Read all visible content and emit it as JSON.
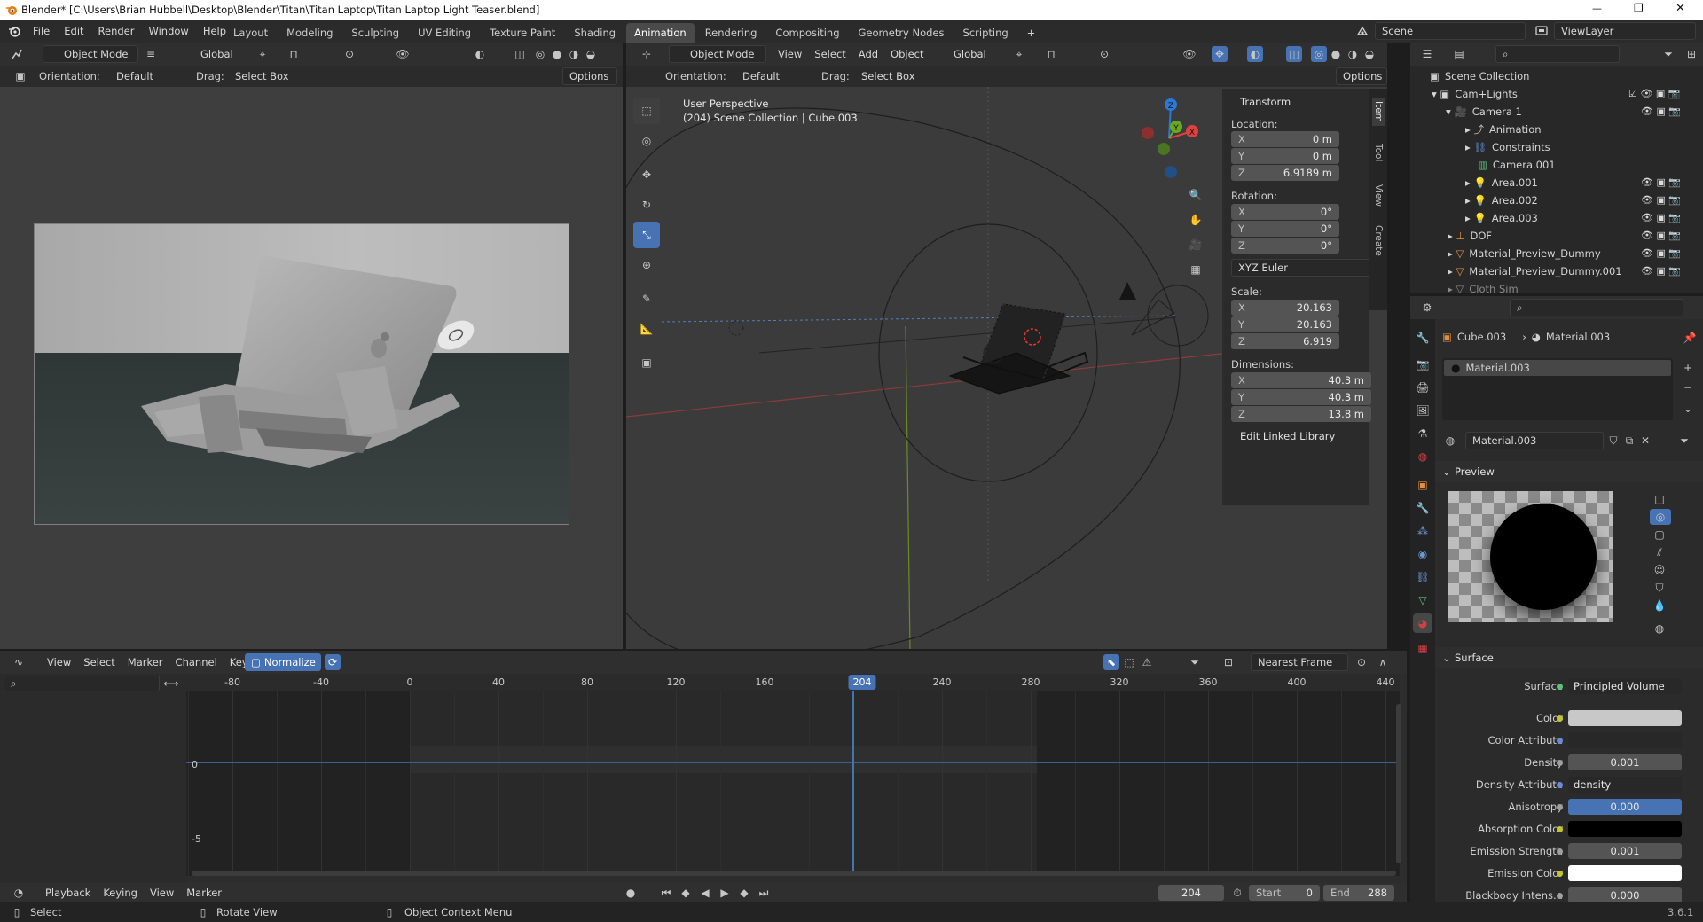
{
  "window": {
    "title": "Blender* [C:\\Users\\Brian Hubbell\\Desktop\\Blender\\Titan\\Titan Laptop\\Titan Laptop Light Teaser.blend]",
    "controls": {
      "minimize": "—",
      "maximize": "❐",
      "close": "✕"
    }
  },
  "menubar": {
    "items": [
      "File",
      "Edit",
      "Render",
      "Window",
      "Help"
    ],
    "workspaces": [
      "Layout",
      "Modeling",
      "Sculpting",
      "UV Editing",
      "Texture Paint",
      "Shading",
      "Animation",
      "Rendering",
      "Compositing",
      "Geometry Nodes",
      "Scripting"
    ],
    "active_workspace": "Animation",
    "add_tab": "+",
    "scene": "Scene",
    "view_layer": "ViewLayer"
  },
  "left_viewport": {
    "mode": "Object Mode",
    "transform": "Global",
    "orientation_label": "Orientation:",
    "orientation_value": "Default",
    "drag_label": "Drag:",
    "drag_value": "Select Box",
    "options": "Options"
  },
  "main_viewport": {
    "mode": "Object Mode",
    "menus": [
      "View",
      "Select",
      "Add",
      "Object"
    ],
    "transform": "Global",
    "orientation_label": "Orientation:",
    "orientation_value": "Default",
    "drag_label": "Drag:",
    "drag_value": "Select Box",
    "options": "Options",
    "overlay_title": "User Perspective",
    "overlay_path": "(204) Scene Collection | Cube.003",
    "side_tabs": [
      "Item",
      "Tool",
      "View",
      "Create"
    ],
    "gizmo": {
      "z": "Z",
      "y": "Y",
      "x": "X"
    }
  },
  "transform_panel": {
    "title": "Transform",
    "location_label": "Location:",
    "location": [
      {
        "k": "X",
        "v": "0 m"
      },
      {
        "k": "Y",
        "v": "0 m"
      },
      {
        "k": "Z",
        "v": "6.9189 m"
      }
    ],
    "rotation_label": "Rotation:",
    "rotation": [
      {
        "k": "X",
        "v": "0°"
      },
      {
        "k": "Y",
        "v": "0°"
      },
      {
        "k": "Z",
        "v": "0°"
      }
    ],
    "rotation_mode": "XYZ Euler",
    "scale_label": "Scale:",
    "scale": [
      {
        "k": "X",
        "v": "20.163"
      },
      {
        "k": "Y",
        "v": "20.163"
      },
      {
        "k": "Z",
        "v": "6.919"
      }
    ],
    "dimensions_label": "Dimensions:",
    "dimensions": [
      {
        "k": "X",
        "v": "40.3 m"
      },
      {
        "k": "Y",
        "v": "40.3 m"
      },
      {
        "k": "Z",
        "v": "13.8 m"
      }
    ],
    "linked_library": "Edit Linked Library"
  },
  "outliner": {
    "rows": [
      {
        "label": "Scene Collection"
      },
      {
        "label": "Cam+Lights"
      },
      {
        "label": "Camera 1"
      },
      {
        "label": "Animation"
      },
      {
        "label": "Constraints"
      },
      {
        "label": "Camera.001"
      },
      {
        "label": "Area.001"
      },
      {
        "label": "Area.002"
      },
      {
        "label": "Area.003"
      },
      {
        "label": "DOF"
      },
      {
        "label": "Material_Preview_Dummy"
      },
      {
        "label": "Material_Preview_Dummy.001"
      },
      {
        "label": "Cloth Sim"
      }
    ]
  },
  "properties": {
    "breadcrumb_object": "Cube.003",
    "breadcrumb_material": "Material.003",
    "slot": "Material.003",
    "material_name": "Material.003",
    "preview_title": "Preview",
    "surface_title": "Surface",
    "surface_label": "Surface",
    "surface_shader": "Principled Volume",
    "rows": [
      {
        "label": "Color",
        "value": "",
        "dot": "#c6c62a",
        "kind": "swatch-grey"
      },
      {
        "label": "Color Attribute",
        "value": "",
        "dot": "#6a8ad6",
        "kind": "dark"
      },
      {
        "label": "Density",
        "value": "0.001",
        "dot": "#a0a0a0",
        "kind": "num"
      },
      {
        "label": "Density Attribute",
        "value": "density",
        "dot": "#6a8ad6",
        "kind": "dark-left"
      },
      {
        "label": "Anisotropy",
        "value": "0.000",
        "dot": "#a0a0a0",
        "kind": "blue"
      },
      {
        "label": "Absorption Color",
        "value": "",
        "dot": "#c6c62a",
        "kind": "swatch-black"
      },
      {
        "label": "Emission Strength",
        "value": "0.001",
        "dot": "#a0a0a0",
        "kind": "num"
      },
      {
        "label": "Emission Color",
        "value": "",
        "dot": "#c6c62a",
        "kind": "swatch-white"
      },
      {
        "label": "Blackbody Intens...",
        "value": "0.000",
        "dot": "#a0a0a0",
        "kind": "num"
      }
    ]
  },
  "graph_editor": {
    "menus": [
      "View",
      "Select",
      "Marker",
      "Channel",
      "Key"
    ],
    "normalize": "Normalize",
    "snap": "Nearest Frame",
    "ruler": [
      "-80",
      "-40",
      "0",
      "40",
      "80",
      "120",
      "160",
      "240",
      "280",
      "320",
      "360",
      "400",
      "440"
    ],
    "current_frame": "204",
    "y_labels": [
      "0",
      "-5"
    ]
  },
  "timeline": {
    "playback": "Playback",
    "keying": "Keying",
    "view": "View",
    "marker": "Marker",
    "frame": "204",
    "start_label": "Start",
    "start": "0",
    "end_label": "End",
    "end": "288"
  },
  "statusbar": {
    "select": "Select",
    "rotate": "Rotate View",
    "context": "Object Context Menu",
    "version": "3.6.1"
  }
}
